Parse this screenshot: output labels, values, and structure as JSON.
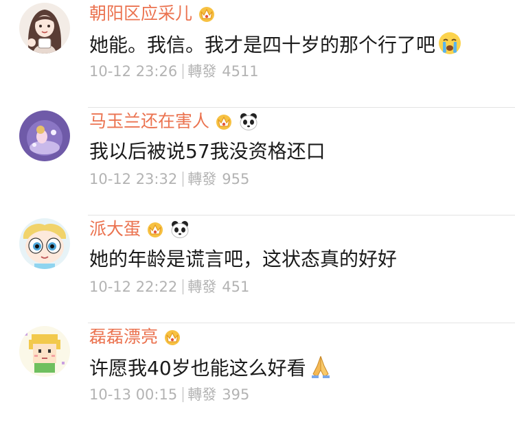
{
  "comments": [
    {
      "username": "朝阳区应采儿",
      "text": "她能。我信。我才是四十岁的那个行了吧",
      "time": "10-12 23:26",
      "repost_label": "轉發",
      "repost_count": "4511",
      "avatar": "girl-with-long-hair-avatar",
      "badges": [
        "crown-vip-badge"
      ],
      "emoji": "crying-face-emoji"
    },
    {
      "username": "马玉兰还在害人",
      "text": "我以后被说57我没资格还口",
      "time": "10-12 23:32",
      "repost_label": "轉發",
      "repost_count": "955",
      "avatar": "purple-cartoon-avatar",
      "badges": [
        "crown-vip-badge",
        "panda-badge"
      ],
      "emoji": ""
    },
    {
      "username": "派大蛋",
      "text": "她的年龄是谎言吧，这状态真的好好",
      "time": "10-12 22:22",
      "repost_label": "轉發",
      "repost_count": "451",
      "avatar": "powerpuff-girl-avatar",
      "badges": [
        "crown-vip-badge",
        "panda-badge"
      ],
      "emoji": ""
    },
    {
      "username": "磊磊漂亮",
      "text": "许愿我40岁也能这么好看",
      "time": "10-13 00:15",
      "repost_label": "轉發",
      "repost_count": "395",
      "avatar": "pixel-blond-boy-avatar",
      "badges": [
        "crown-vip-badge"
      ],
      "emoji": "praying-hands-emoji"
    }
  ],
  "colors": {
    "username": "#eb7350",
    "text": "#1a1a1a",
    "meta": "#b3b3b3",
    "divider": "#e3e3e3"
  }
}
